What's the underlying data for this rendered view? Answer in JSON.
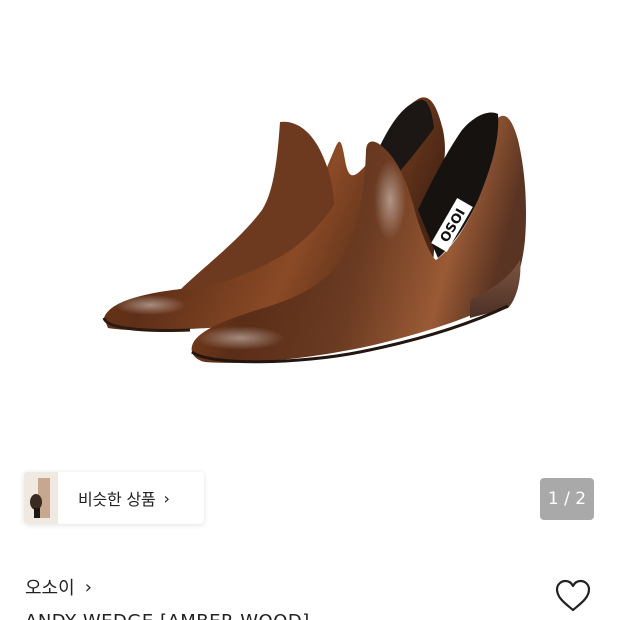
{
  "product": {
    "image_counter": "1 / 2",
    "brand": "오소이",
    "title": "ANDY WEDGE [AMBER WOOD]",
    "similar_label": "비슷한 상품",
    "shoe_logo": "OSOI"
  },
  "icons": {
    "chevron": "›",
    "wishlist": "heart-outline-icon"
  },
  "colors": {
    "leather": "#6b3518",
    "counter_bg": "#a9a9a9"
  }
}
